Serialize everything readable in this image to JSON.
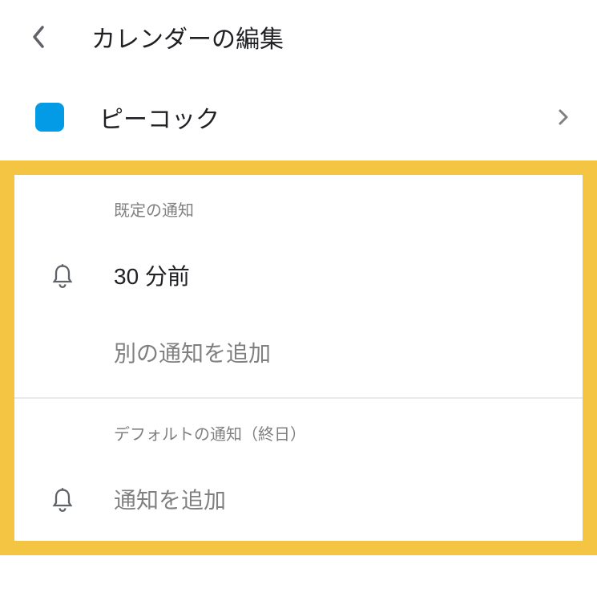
{
  "header": {
    "title": "カレンダーの編集"
  },
  "calendar": {
    "name": "ピーコック",
    "color": "#039be5"
  },
  "sections": {
    "default_notifications": {
      "header": "既定の通知",
      "items": [
        {
          "label": "30 分前"
        }
      ],
      "add_label": "別の通知を追加"
    },
    "allday_notifications": {
      "header": "デフォルトの通知（終日）",
      "add_label": "通知を追加"
    }
  },
  "colors": {
    "highlight": "#f4c542",
    "icon_gray": "#5f6368",
    "text_gray": "#808080"
  }
}
